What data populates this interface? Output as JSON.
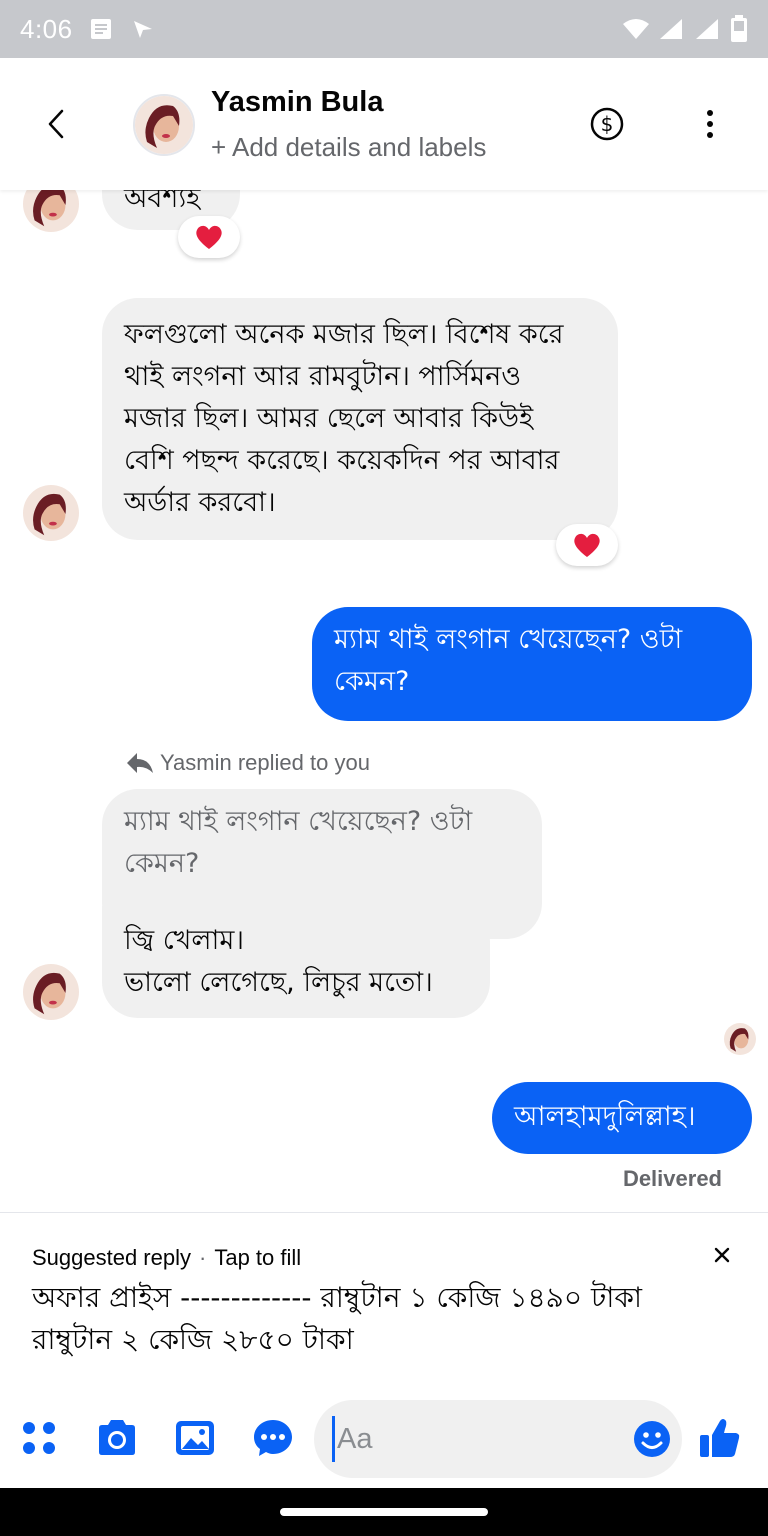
{
  "status_bar": {
    "time": "4:06"
  },
  "header": {
    "contact_name": "Yasmin Bula",
    "subtitle": "+ Add details and labels"
  },
  "messages": {
    "partial_text": "অবশ্যই",
    "partial_reaction": "❤️",
    "message_1": "ফলগুলো অনেক মজার ছিল। বিশেষ করে\nথাই লংগনা আর রামবুটান। পার্সিমনও\nমজার ছিল। আমর ছেলে আবার কিউই\nবেশি পছন্দ করেছে। কয়েকদিন পর আবার\nঅর্ডার করবো।",
    "message_1_reaction": "❤️",
    "outgoing_1": "ম্যাম থাই লংগান খেয়েছেন? ওটা\nকেমন?",
    "reply_label": "Yasmin replied to you",
    "quoted_text": "ম্যাম থাই লংগান খেয়েছেন? ওটা\nকেমন?",
    "reply_text": "জ্বি খেলাম।\nভালো লেগেছে, লিচুর মতো।",
    "outgoing_2": "আলহামদুলিল্লাহ।",
    "delivered": "Delivered"
  },
  "suggested_reply": {
    "title": "Suggested reply",
    "hint": "Tap to fill",
    "text": "অফার প্রাইস ------------- রাম্বুটান ১ কেজি ১৪৯০ টাকা\nরাম্বুটান ২ কেজি ২৮৫০ টাকা"
  },
  "composer": {
    "placeholder": "Aa"
  },
  "colors": {
    "accent": "#0a62f5",
    "incoming_bubble": "#f0f0f0",
    "reaction_heart": "#e41e3f",
    "status_bar": "#c6c8cc"
  }
}
